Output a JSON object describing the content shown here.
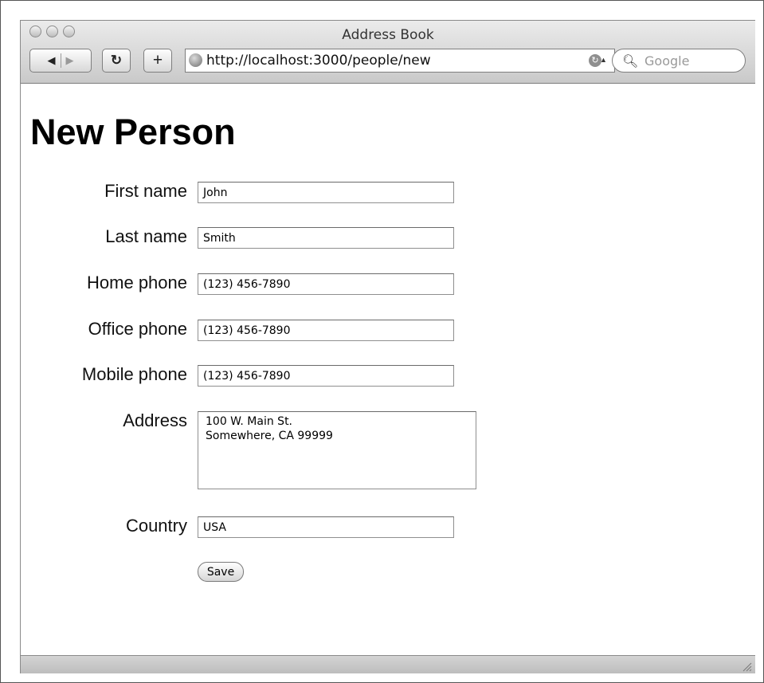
{
  "window": {
    "title": "Address Book"
  },
  "toolbar": {
    "back_icon": "back-arrow-icon",
    "forward_icon": "forward-arrow-icon",
    "reload_icon": "reload-icon",
    "add_bookmark_icon": "plus-icon",
    "url": "http://localhost:3000/people/new",
    "search_placeholder": "Google"
  },
  "page": {
    "heading": "New Person",
    "fields": [
      {
        "label": "First name",
        "value": "John"
      },
      {
        "label": "Last name",
        "value": "Smith"
      },
      {
        "label": "Home phone",
        "value": "(123) 456-7890"
      },
      {
        "label": "Office phone",
        "value": "(123) 456-7890"
      },
      {
        "label": "Mobile phone",
        "value": "(123) 456-7890"
      }
    ],
    "address": {
      "label": "Address",
      "value": "100 W. Main St.\nSomewhere, CA 99999"
    },
    "country": {
      "label": "Country",
      "value": "USA"
    },
    "save_label": "Save"
  }
}
